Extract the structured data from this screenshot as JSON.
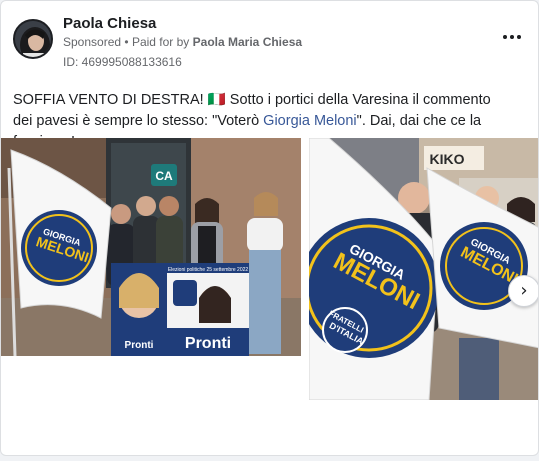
{
  "post": {
    "author_name": "Paola Chiesa",
    "sponsored_label": "Sponsored",
    "separator": "•",
    "paid_for_by_prefix": "Paid for by",
    "paid_for_by_name": "Paola Maria Chiesa",
    "ad_id": "ID: 469995088133616",
    "text_before": "SOFFIA VENTO DI DESTRA! ",
    "text_emoji": "🇮🇹",
    "text_middle": " Sotto i portici della Varesina il commento dei pavesi è sempre lo stesso: \"Voterò ",
    "text_link": "Giorgia Meloni",
    "text_after": "\". Dai, dai che ce la facciamo!"
  },
  "photo1": {
    "bank_logo": "CA",
    "poster_top": "Giorgia Meloni",
    "poster_date": "Elezioni politiche 25 settembre 2022",
    "poster_bottom": "Pronti",
    "poster_bottom2": "Pronti"
  },
  "photo2": {
    "shop_sign": "KIKO"
  },
  "flag": {
    "line1": "GIORGIA",
    "line2": "MELONI",
    "line3": "FRATELLI",
    "line4": "D'ITALIA"
  },
  "colors": {
    "link": "#385898",
    "flag_blue": "#1f3d7a",
    "flag_yellow": "#f2c21b",
    "secondary_text": "#65676b"
  },
  "icons": {
    "more": "more-horizontal-icon",
    "next": "chevron-right-icon"
  }
}
